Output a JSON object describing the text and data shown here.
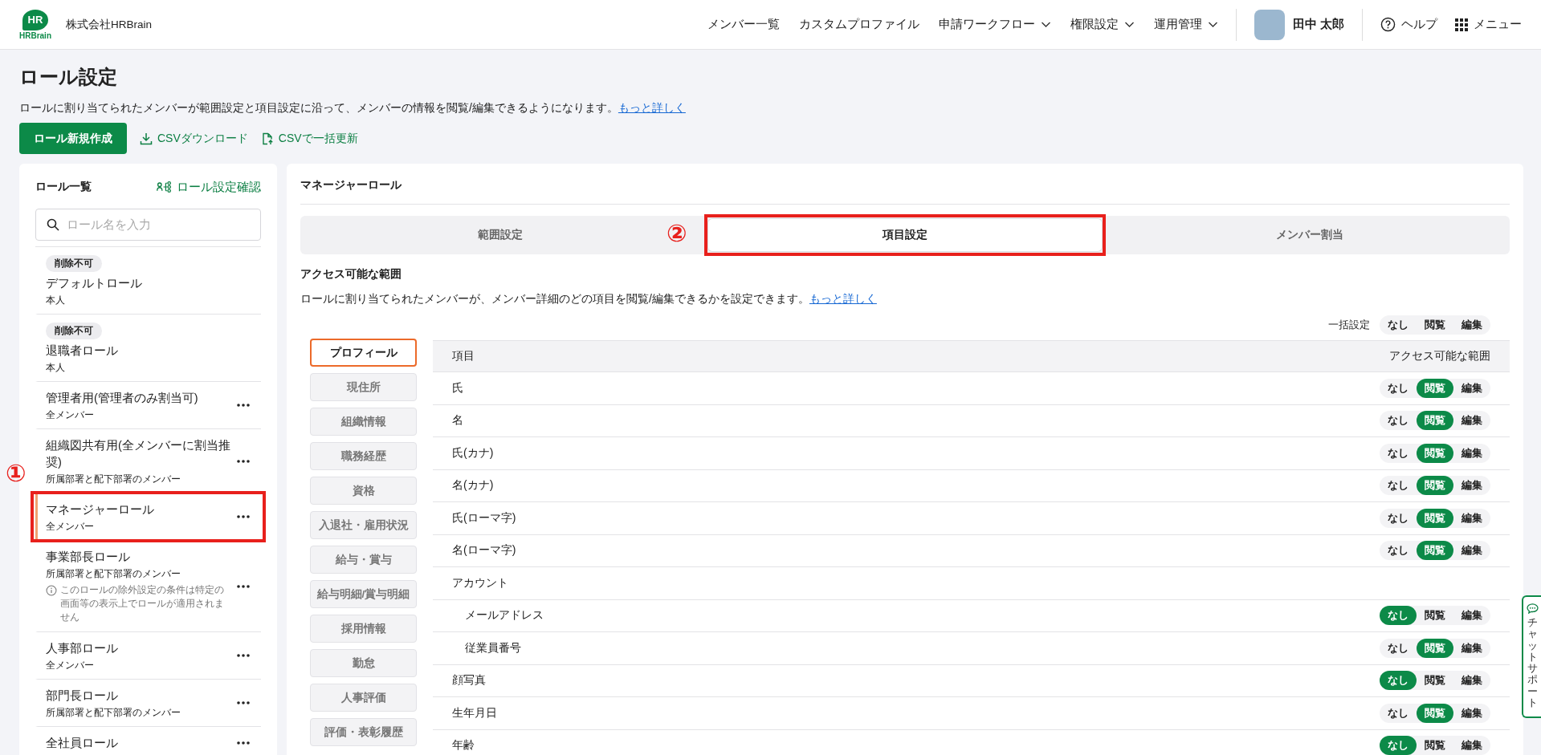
{
  "header": {
    "logo": {
      "mark": "HR",
      "wordmark": "HRBrain"
    },
    "company": "株式会社HRBrain",
    "nav": [
      {
        "label": "メンバー一覧",
        "dropdown": false
      },
      {
        "label": "カスタムプロファイル",
        "dropdown": false
      },
      {
        "label": "申請ワークフロー",
        "dropdown": true
      },
      {
        "label": "権限設定",
        "dropdown": true
      },
      {
        "label": "運用管理",
        "dropdown": true
      }
    ],
    "user": "田中 太郎",
    "help": "ヘルプ",
    "menu": "メニュー"
  },
  "page": {
    "title": "ロール設定",
    "description": {
      "text": "ロールに割り当てられたメンバーが範囲設定と項目設定に沿って、メンバーの情報を閲覧/編集できるようになります。",
      "link": "もっと詳しく"
    },
    "actions": {
      "create": "ロール新規作成",
      "download": "CSVダウンロード",
      "bulk_update": "CSVで一括更新"
    }
  },
  "role_list": {
    "title": "ロール一覧",
    "check_link": "ロール設定確認",
    "search": {
      "placeholder": "ロール名を入力"
    },
    "items": [
      {
        "badge": "削除不可",
        "name": "デフォルトロール",
        "scope": "本人",
        "menu": false,
        "selected": false
      },
      {
        "badge": "削除不可",
        "name": "退職者ロール",
        "scope": "本人",
        "menu": false,
        "selected": false
      },
      {
        "name": "管理者用(管理者のみ割当可)",
        "scope": "全メンバー",
        "menu": true,
        "selected": false
      },
      {
        "name": "組織図共有用(全メンバーに割当推奨)",
        "scope": "所属部署と配下部署のメンバー",
        "menu": true,
        "selected": false
      },
      {
        "name": "マネージャーロール",
        "scope": "全メンバー",
        "menu": true,
        "selected": true,
        "annotation": "①"
      },
      {
        "name": "事業部長ロール",
        "scope": "所属部署と配下部署のメンバー",
        "note": "このロールの除外設定の条件は特定の画面等の表示上でロールが適用されません",
        "menu": true,
        "selected": false
      },
      {
        "name": "人事部ロール",
        "scope": "全メンバー",
        "menu": true,
        "selected": false
      },
      {
        "name": "部門長ロール",
        "scope": "所属部署と配下部署のメンバー",
        "menu": true,
        "selected": false
      },
      {
        "name": "全社員ロール",
        "menu": true,
        "selected": false
      }
    ]
  },
  "detail": {
    "title": "マネージャーロール",
    "tabs": [
      {
        "label": "範囲設定",
        "selected": false
      },
      {
        "label": "項目設定",
        "selected": true,
        "annotation": "②"
      },
      {
        "label": "メンバー割当",
        "selected": false
      }
    ],
    "section_title": "アクセス可能な範囲",
    "section_description": {
      "text": "ロールに割り当てられたメンバーが、メンバー詳細のどの項目を閲覧/編集できるかを設定できます。",
      "link": "もっと詳しく"
    },
    "categories": [
      {
        "label": "プロフィール",
        "selected": true
      },
      {
        "label": "現住所",
        "selected": false
      },
      {
        "label": "組織情報",
        "selected": false
      },
      {
        "label": "職務経歴",
        "selected": false
      },
      {
        "label": "資格",
        "selected": false
      },
      {
        "label": "入退社・雇用状況",
        "selected": false
      },
      {
        "label": "給与・賞与",
        "selected": false
      },
      {
        "label": "給与明細/賞与明細",
        "selected": false
      },
      {
        "label": "採用情報",
        "selected": false
      },
      {
        "label": "勤怠",
        "selected": false
      },
      {
        "label": "人事評価",
        "selected": false
      },
      {
        "label": "評価・表彰履歴",
        "selected": false
      }
    ],
    "bulk": {
      "label": "一括設定",
      "options": [
        {
          "label": "なし",
          "selected": false
        },
        {
          "label": "閲覧",
          "selected": false
        },
        {
          "label": "編集",
          "selected": false
        }
      ]
    },
    "table": {
      "columns": [
        "項目",
        "アクセス可能な範囲"
      ],
      "rows": [
        {
          "label": "氏",
          "options": [
            {
              "label": "なし",
              "selected": false
            },
            {
              "label": "閲覧",
              "selected": true
            },
            {
              "label": "編集",
              "selected": false
            }
          ]
        },
        {
          "label": "名",
          "options": [
            {
              "label": "なし",
              "selected": false
            },
            {
              "label": "閲覧",
              "selected": true
            },
            {
              "label": "編集",
              "selected": false
            }
          ]
        },
        {
          "label": "氏(カナ)",
          "options": [
            {
              "label": "なし",
              "selected": false
            },
            {
              "label": "閲覧",
              "selected": true
            },
            {
              "label": "編集",
              "selected": false
            }
          ]
        },
        {
          "label": "名(カナ)",
          "options": [
            {
              "label": "なし",
              "selected": false
            },
            {
              "label": "閲覧",
              "selected": true
            },
            {
              "label": "編集",
              "selected": false
            }
          ]
        },
        {
          "label": "氏(ローマ字)",
          "options": [
            {
              "label": "なし",
              "selected": false
            },
            {
              "label": "閲覧",
              "selected": true
            },
            {
              "label": "編集",
              "selected": false
            }
          ]
        },
        {
          "label": "名(ローマ字)",
          "options": [
            {
              "label": "なし",
              "selected": false
            },
            {
              "label": "閲覧",
              "selected": true
            },
            {
              "label": "編集",
              "selected": false
            }
          ]
        },
        {
          "label": "アカウント",
          "children": [
            {
              "label": "メールアドレス",
              "options": [
                {
                  "label": "なし",
                  "selected": true
                },
                {
                  "label": "閲覧",
                  "selected": false
                },
                {
                  "label": "編集",
                  "selected": false
                }
              ]
            },
            {
              "label": "従業員番号",
              "options": [
                {
                  "label": "なし",
                  "selected": false
                },
                {
                  "label": "閲覧",
                  "selected": true
                },
                {
                  "label": "編集",
                  "selected": false
                }
              ]
            }
          ]
        },
        {
          "label": "顔写真",
          "options": [
            {
              "label": "なし",
              "selected": true
            },
            {
              "label": "閲覧",
              "selected": false
            },
            {
              "label": "編集",
              "selected": false
            }
          ]
        },
        {
          "label": "生年月日",
          "options": [
            {
              "label": "なし",
              "selected": false
            },
            {
              "label": "閲覧",
              "selected": true
            },
            {
              "label": "編集",
              "selected": false
            }
          ]
        },
        {
          "label": "年齢",
          "options": [
            {
              "label": "なし",
              "selected": true
            },
            {
              "label": "閲覧",
              "selected": false
            },
            {
              "label": "編集",
              "selected": false
            }
          ]
        }
      ]
    }
  },
  "chat_support": {
    "label": "チャットサポート"
  }
}
